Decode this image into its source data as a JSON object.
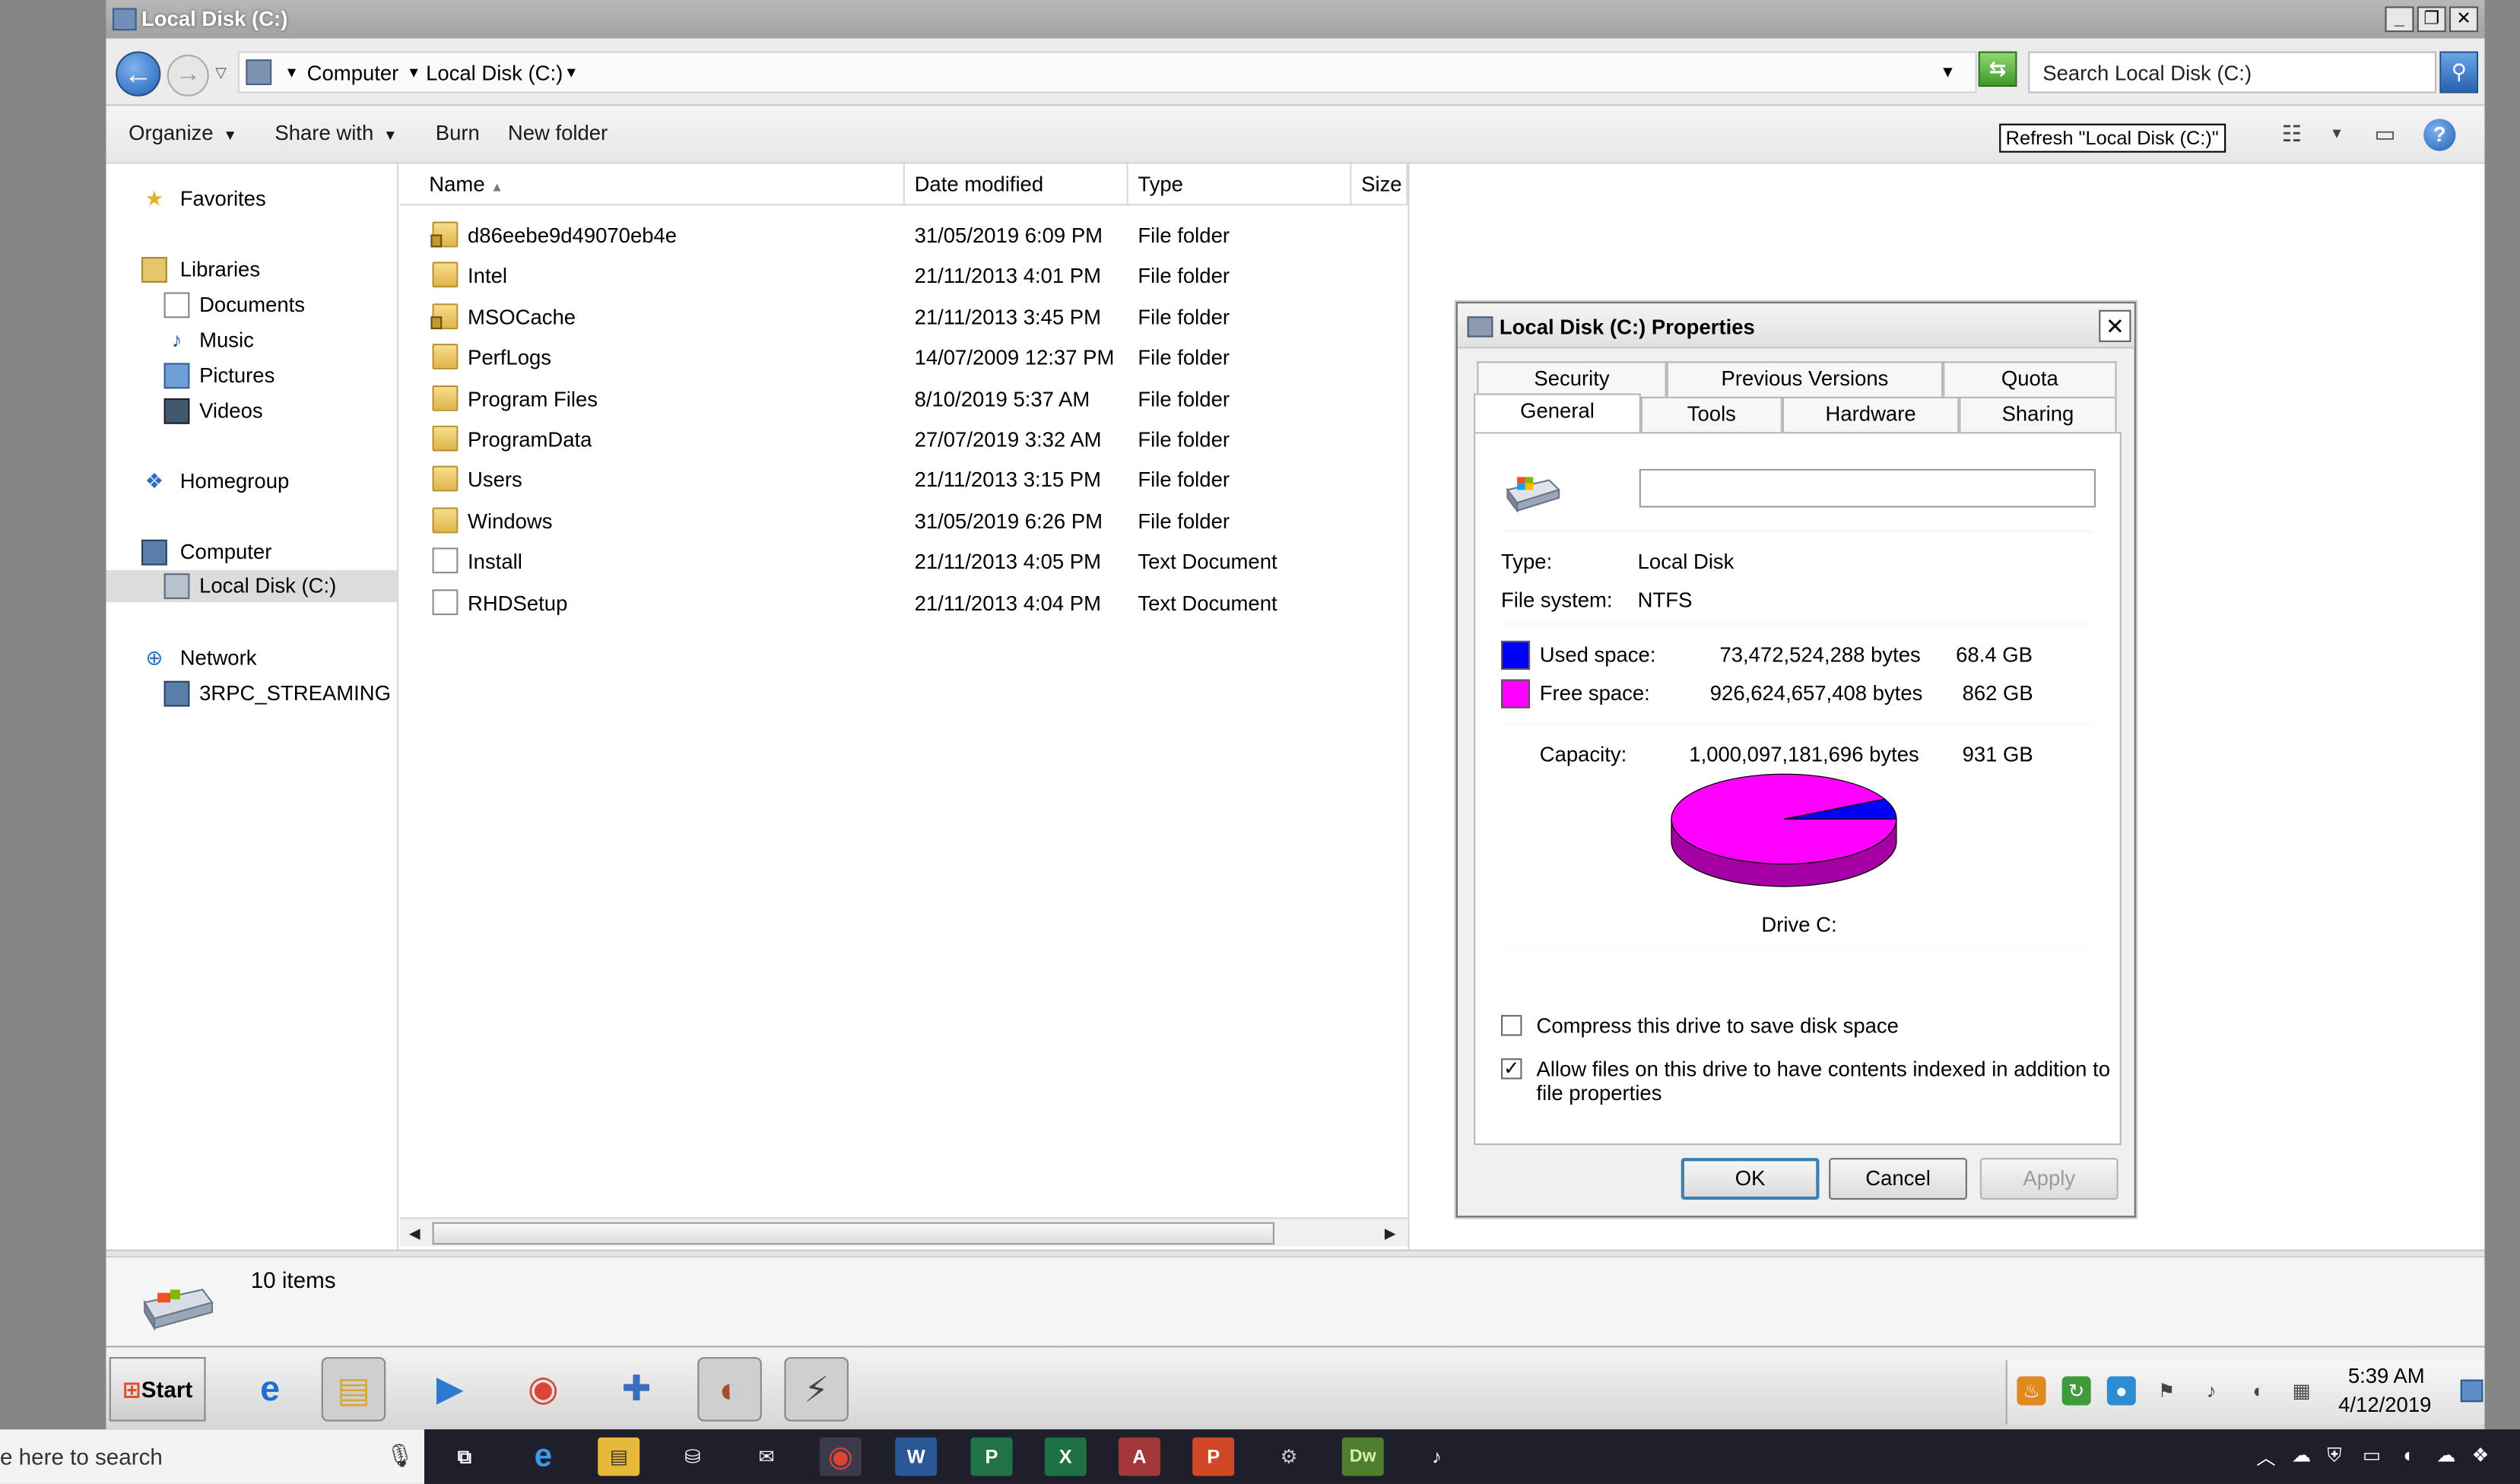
{
  "window": {
    "title": "Local Disk (C:)",
    "controls": {
      "minimize": "_",
      "restore": "❐",
      "close": "✕"
    }
  },
  "address": {
    "breadcrumb": [
      "Computer",
      "Local Disk (C:)"
    ],
    "search_placeholder": "Search Local Disk (C:)"
  },
  "toolbar": {
    "organize": "Organize",
    "share_with": "Share with",
    "burn": "Burn",
    "new_folder": "New folder",
    "tooltip": "Refresh \"Local Disk (C:)\""
  },
  "nav": {
    "favorites": "Favorites",
    "libraries": "Libraries",
    "documents": "Documents",
    "music": "Music",
    "pictures": "Pictures",
    "videos": "Videos",
    "homegroup": "Homegroup",
    "computer": "Computer",
    "local_disk": "Local Disk (C:)",
    "network": "Network",
    "network_host": "3RPC_STREAMING"
  },
  "columns": {
    "name": "Name",
    "date": "Date modified",
    "type": "Type",
    "size": "Size"
  },
  "files": [
    {
      "name": "d86eebe9d49070eb4e",
      "date": "31/05/2019 6:09 PM",
      "type": "File folder",
      "kind": "folder-locked"
    },
    {
      "name": "Intel",
      "date": "21/11/2013 4:01 PM",
      "type": "File folder",
      "kind": "folder"
    },
    {
      "name": "MSOCache",
      "date": "21/11/2013 3:45 PM",
      "type": "File folder",
      "kind": "folder-locked"
    },
    {
      "name": "PerfLogs",
      "date": "14/07/2009 12:37 PM",
      "type": "File folder",
      "kind": "folder"
    },
    {
      "name": "Program Files",
      "date": "8/10/2019 5:37 AM",
      "type": "File folder",
      "kind": "folder"
    },
    {
      "name": "ProgramData",
      "date": "27/07/2019 3:32 AM",
      "type": "File folder",
      "kind": "folder"
    },
    {
      "name": "Users",
      "date": "21/11/2013 3:15 PM",
      "type": "File folder",
      "kind": "folder"
    },
    {
      "name": "Windows",
      "date": "31/05/2019 6:26 PM",
      "type": "File folder",
      "kind": "folder"
    },
    {
      "name": "Install",
      "date": "21/11/2013 4:05 PM",
      "type": "Text Document",
      "kind": "document"
    },
    {
      "name": "RHDSetup",
      "date": "21/11/2013 4:04 PM",
      "type": "Text Document",
      "kind": "document"
    }
  ],
  "details": {
    "items_count": "10 items"
  },
  "taskbar_old": {
    "start": "Start",
    "clock_time": "5:39 AM",
    "clock_date": "4/12/2019"
  },
  "dialog": {
    "title": "Local Disk (C:) Properties",
    "tabs_row1": [
      "Security",
      "Previous Versions",
      "Quota"
    ],
    "tabs_row2": [
      "General",
      "Tools",
      "Hardware",
      "Sharing"
    ],
    "active_tab": "General",
    "label_value": "",
    "type_label": "Type:",
    "type_value": "Local Disk",
    "fs_label": "File system:",
    "fs_value": "NTFS",
    "used_label": "Used space:",
    "used_bytes": "73,472,524,288 bytes",
    "used_gb": "68.4 GB",
    "free_label": "Free space:",
    "free_bytes": "926,624,657,408 bytes",
    "free_gb": "862 GB",
    "capacity_label": "Capacity:",
    "capacity_bytes": "1,000,097,181,696 bytes",
    "capacity_gb": "931 GB",
    "drive_label": "Drive C:",
    "compress_label": "Compress this drive to save disk space",
    "compress_checked": false,
    "index_label_1": "Allow files on this drive to have contents indexed in addition to",
    "index_label_2": "file properties",
    "index_checked": true,
    "ok": "OK",
    "cancel": "Cancel",
    "apply": "Apply",
    "used_color": "#0000ff",
    "free_color": "#ff00ff"
  },
  "chart_data": {
    "type": "pie",
    "categories": [
      "Used space",
      "Free space"
    ],
    "values": [
      73472524288,
      926624657408
    ]
  },
  "host_taskbar": {
    "search_text": "e here to search"
  }
}
